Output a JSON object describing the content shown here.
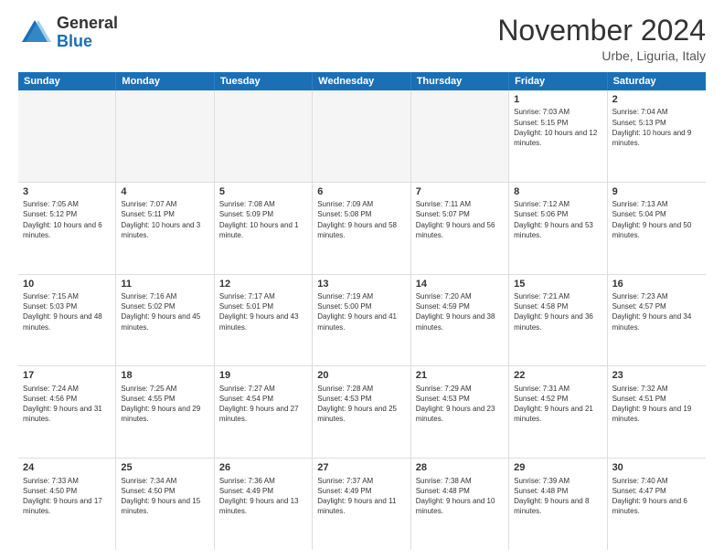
{
  "logo": {
    "general": "General",
    "blue": "Blue"
  },
  "header": {
    "month": "November 2024",
    "location": "Urbe, Liguria, Italy"
  },
  "weekdays": [
    "Sunday",
    "Monday",
    "Tuesday",
    "Wednesday",
    "Thursday",
    "Friday",
    "Saturday"
  ],
  "rows": [
    [
      {
        "day": "",
        "info": ""
      },
      {
        "day": "",
        "info": ""
      },
      {
        "day": "",
        "info": ""
      },
      {
        "day": "",
        "info": ""
      },
      {
        "day": "",
        "info": ""
      },
      {
        "day": "1",
        "info": "Sunrise: 7:03 AM\nSunset: 5:15 PM\nDaylight: 10 hours and 12 minutes."
      },
      {
        "day": "2",
        "info": "Sunrise: 7:04 AM\nSunset: 5:13 PM\nDaylight: 10 hours and 9 minutes."
      }
    ],
    [
      {
        "day": "3",
        "info": "Sunrise: 7:05 AM\nSunset: 5:12 PM\nDaylight: 10 hours and 6 minutes."
      },
      {
        "day": "4",
        "info": "Sunrise: 7:07 AM\nSunset: 5:11 PM\nDaylight: 10 hours and 3 minutes."
      },
      {
        "day": "5",
        "info": "Sunrise: 7:08 AM\nSunset: 5:09 PM\nDaylight: 10 hours and 1 minute."
      },
      {
        "day": "6",
        "info": "Sunrise: 7:09 AM\nSunset: 5:08 PM\nDaylight: 9 hours and 58 minutes."
      },
      {
        "day": "7",
        "info": "Sunrise: 7:11 AM\nSunset: 5:07 PM\nDaylight: 9 hours and 56 minutes."
      },
      {
        "day": "8",
        "info": "Sunrise: 7:12 AM\nSunset: 5:06 PM\nDaylight: 9 hours and 53 minutes."
      },
      {
        "day": "9",
        "info": "Sunrise: 7:13 AM\nSunset: 5:04 PM\nDaylight: 9 hours and 50 minutes."
      }
    ],
    [
      {
        "day": "10",
        "info": "Sunrise: 7:15 AM\nSunset: 5:03 PM\nDaylight: 9 hours and 48 minutes."
      },
      {
        "day": "11",
        "info": "Sunrise: 7:16 AM\nSunset: 5:02 PM\nDaylight: 9 hours and 45 minutes."
      },
      {
        "day": "12",
        "info": "Sunrise: 7:17 AM\nSunset: 5:01 PM\nDaylight: 9 hours and 43 minutes."
      },
      {
        "day": "13",
        "info": "Sunrise: 7:19 AM\nSunset: 5:00 PM\nDaylight: 9 hours and 41 minutes."
      },
      {
        "day": "14",
        "info": "Sunrise: 7:20 AM\nSunset: 4:59 PM\nDaylight: 9 hours and 38 minutes."
      },
      {
        "day": "15",
        "info": "Sunrise: 7:21 AM\nSunset: 4:58 PM\nDaylight: 9 hours and 36 minutes."
      },
      {
        "day": "16",
        "info": "Sunrise: 7:23 AM\nSunset: 4:57 PM\nDaylight: 9 hours and 34 minutes."
      }
    ],
    [
      {
        "day": "17",
        "info": "Sunrise: 7:24 AM\nSunset: 4:56 PM\nDaylight: 9 hours and 31 minutes."
      },
      {
        "day": "18",
        "info": "Sunrise: 7:25 AM\nSunset: 4:55 PM\nDaylight: 9 hours and 29 minutes."
      },
      {
        "day": "19",
        "info": "Sunrise: 7:27 AM\nSunset: 4:54 PM\nDaylight: 9 hours and 27 minutes."
      },
      {
        "day": "20",
        "info": "Sunrise: 7:28 AM\nSunset: 4:53 PM\nDaylight: 9 hours and 25 minutes."
      },
      {
        "day": "21",
        "info": "Sunrise: 7:29 AM\nSunset: 4:53 PM\nDaylight: 9 hours and 23 minutes."
      },
      {
        "day": "22",
        "info": "Sunrise: 7:31 AM\nSunset: 4:52 PM\nDaylight: 9 hours and 21 minutes."
      },
      {
        "day": "23",
        "info": "Sunrise: 7:32 AM\nSunset: 4:51 PM\nDaylight: 9 hours and 19 minutes."
      }
    ],
    [
      {
        "day": "24",
        "info": "Sunrise: 7:33 AM\nSunset: 4:50 PM\nDaylight: 9 hours and 17 minutes."
      },
      {
        "day": "25",
        "info": "Sunrise: 7:34 AM\nSunset: 4:50 PM\nDaylight: 9 hours and 15 minutes."
      },
      {
        "day": "26",
        "info": "Sunrise: 7:36 AM\nSunset: 4:49 PM\nDaylight: 9 hours and 13 minutes."
      },
      {
        "day": "27",
        "info": "Sunrise: 7:37 AM\nSunset: 4:49 PM\nDaylight: 9 hours and 11 minutes."
      },
      {
        "day": "28",
        "info": "Sunrise: 7:38 AM\nSunset: 4:48 PM\nDaylight: 9 hours and 10 minutes."
      },
      {
        "day": "29",
        "info": "Sunrise: 7:39 AM\nSunset: 4:48 PM\nDaylight: 9 hours and 8 minutes."
      },
      {
        "day": "30",
        "info": "Sunrise: 7:40 AM\nSunset: 4:47 PM\nDaylight: 9 hours and 6 minutes."
      }
    ]
  ]
}
